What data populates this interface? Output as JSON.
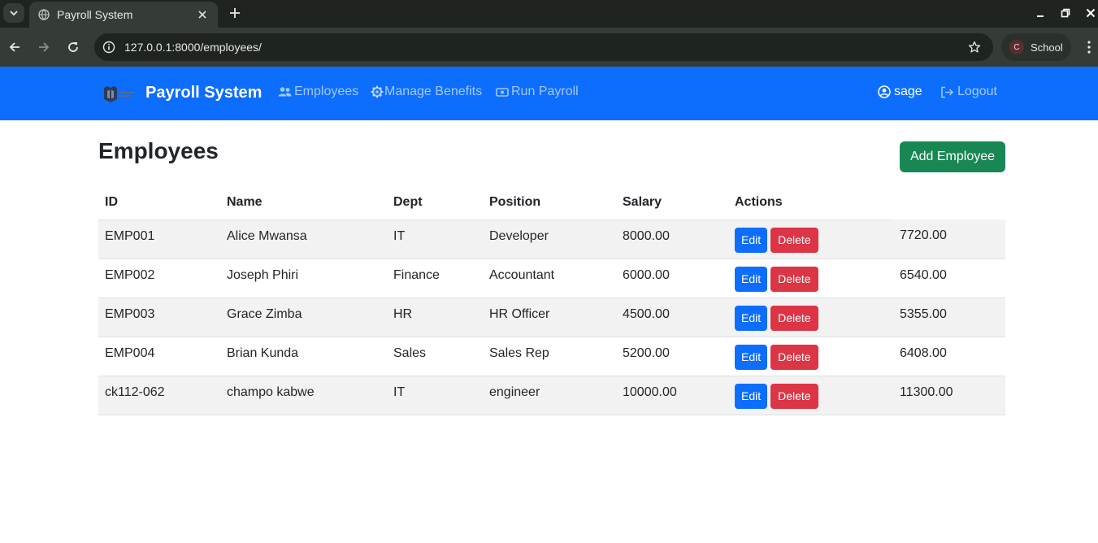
{
  "browser": {
    "tab_title": "Payroll System",
    "url": "127.0.0.1:8000/employees/",
    "profile_initial": "C",
    "profile_name": "School"
  },
  "navbar": {
    "brand": "Payroll System",
    "links": [
      "Employees",
      "Manage Benefits",
      "Run Payroll"
    ],
    "user": "sage",
    "logout": "Logout"
  },
  "page": {
    "title": "Employees",
    "add_button": "Add Employee"
  },
  "table": {
    "headers": [
      "ID",
      "Name",
      "Dept",
      "Position",
      "Salary",
      "Actions",
      ""
    ],
    "edit_label": "Edit",
    "delete_label": "Delete",
    "rows": [
      [
        "EMP001",
        "Alice Mwansa",
        "IT",
        "Developer",
        "8000.00",
        "7720.00"
      ],
      [
        "EMP002",
        "Joseph Phiri",
        "Finance",
        "Accountant",
        "6000.00",
        "6540.00"
      ],
      [
        "EMP003",
        "Grace Zimba",
        "HR",
        "HR Officer",
        "4500.00",
        "5355.00"
      ],
      [
        "EMP004",
        "Brian Kunda",
        "Sales",
        "Sales Rep",
        "5200.00",
        "6408.00"
      ],
      [
        "ck112-062",
        "champo kabwe",
        "IT",
        "engineer",
        "10000.00",
        "11300.00"
      ]
    ]
  },
  "colors": {
    "navbar": "#0d6efd",
    "add_button": "#198754",
    "edit_button": "#0d6efd",
    "delete_button": "#dc3545"
  }
}
